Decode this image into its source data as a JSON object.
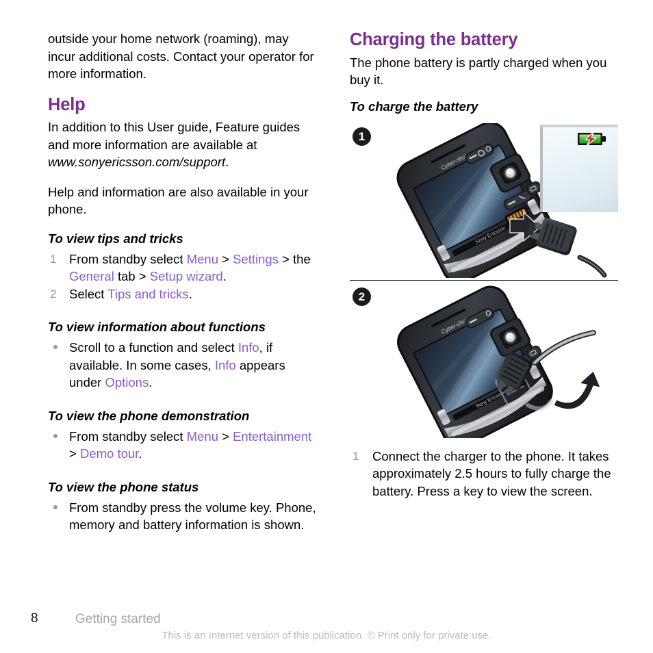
{
  "colors": {
    "heading_purple": "#7B2D8E",
    "link_purple": "#8B5CC7",
    "marker_grey": "#9A9A9A",
    "footer_grey": "#A6A6A6",
    "disclaimer_grey": "#BDBDBD",
    "badge_black": "#1B1B1B",
    "battery_green": "#4FBF3F",
    "battery_bolt_red": "#D81F26"
  },
  "left_column": {
    "continued_paragraph": "outside your home network (roaming), may incur additional costs. Contact your operator for more information.",
    "help_heading": "Help",
    "help_paragraph_1_before": "In addition to this User guide, Feature guides and more information are available at ",
    "help_paragraph_1_url": "www.sonyericsson.com/support",
    "help_paragraph_1_after": ".",
    "help_paragraph_2": "Help and information are also available in your phone.",
    "tips_heading": "To view tips and tricks",
    "tips_steps": [
      {
        "number": "1",
        "parts": [
          {
            "text": "From standby select ",
            "style": "plain"
          },
          {
            "text": "Menu",
            "style": "link"
          },
          {
            "text": " > ",
            "style": "plain"
          },
          {
            "text": "Settings",
            "style": "link"
          },
          {
            "text": " > the ",
            "style": "plain"
          },
          {
            "text": "General",
            "style": "link"
          },
          {
            "text": " tab > ",
            "style": "plain"
          },
          {
            "text": "Setup wizard",
            "style": "link"
          },
          {
            "text": ".",
            "style": "plain"
          }
        ]
      },
      {
        "number": "2",
        "parts": [
          {
            "text": "Select ",
            "style": "plain"
          },
          {
            "text": "Tips and tricks",
            "style": "link"
          },
          {
            "text": ".",
            "style": "plain"
          }
        ]
      }
    ],
    "functions_heading": "To view information about functions",
    "functions_bullets": [
      {
        "parts": [
          {
            "text": "Scroll to a function and select ",
            "style": "plain"
          },
          {
            "text": "Info",
            "style": "link"
          },
          {
            "text": ", if available. In some cases, ",
            "style": "plain"
          },
          {
            "text": "Info",
            "style": "link"
          },
          {
            "text": " appears under ",
            "style": "plain"
          },
          {
            "text": "Options",
            "style": "link"
          },
          {
            "text": ".",
            "style": "plain"
          }
        ]
      }
    ],
    "demo_heading": "To view the phone demonstration",
    "demo_bullets": [
      {
        "parts": [
          {
            "text": "From standby select ",
            "style": "plain"
          },
          {
            "text": "Menu",
            "style": "link"
          },
          {
            "text": " > ",
            "style": "plain"
          },
          {
            "text": "Entertainment",
            "style": "link"
          },
          {
            "text": " > ",
            "style": "plain"
          },
          {
            "text": "Demo tour",
            "style": "link"
          },
          {
            "text": ".",
            "style": "plain"
          }
        ]
      }
    ],
    "status_heading": "To view the phone status",
    "status_bullets": [
      {
        "parts": [
          {
            "text": "From standby press the volume key. Phone, memory and battery information is shown.",
            "style": "plain"
          }
        ]
      }
    ]
  },
  "right_column": {
    "charging_heading": "Charging the battery",
    "charging_paragraph": "The phone battery is partly charged when you buy it.",
    "charge_proc_heading": "To charge the battery",
    "figures": [
      {
        "badge": "1",
        "icon": "phone-with-charger-illustration",
        "battery_icon": "battery-charging-icon"
      },
      {
        "badge": "2",
        "icon": "phone-charger-connected-illustration"
      }
    ],
    "charge_steps": [
      {
        "number": "1",
        "text": "Connect the charger to the phone. It takes approximately 2.5 hours to fully charge the battery. Press a key to view the screen."
      }
    ]
  },
  "footer": {
    "page_number": "8",
    "section_name": "Getting started",
    "disclaimer": "This is an Internet version of this publication. © Print only for private use."
  }
}
